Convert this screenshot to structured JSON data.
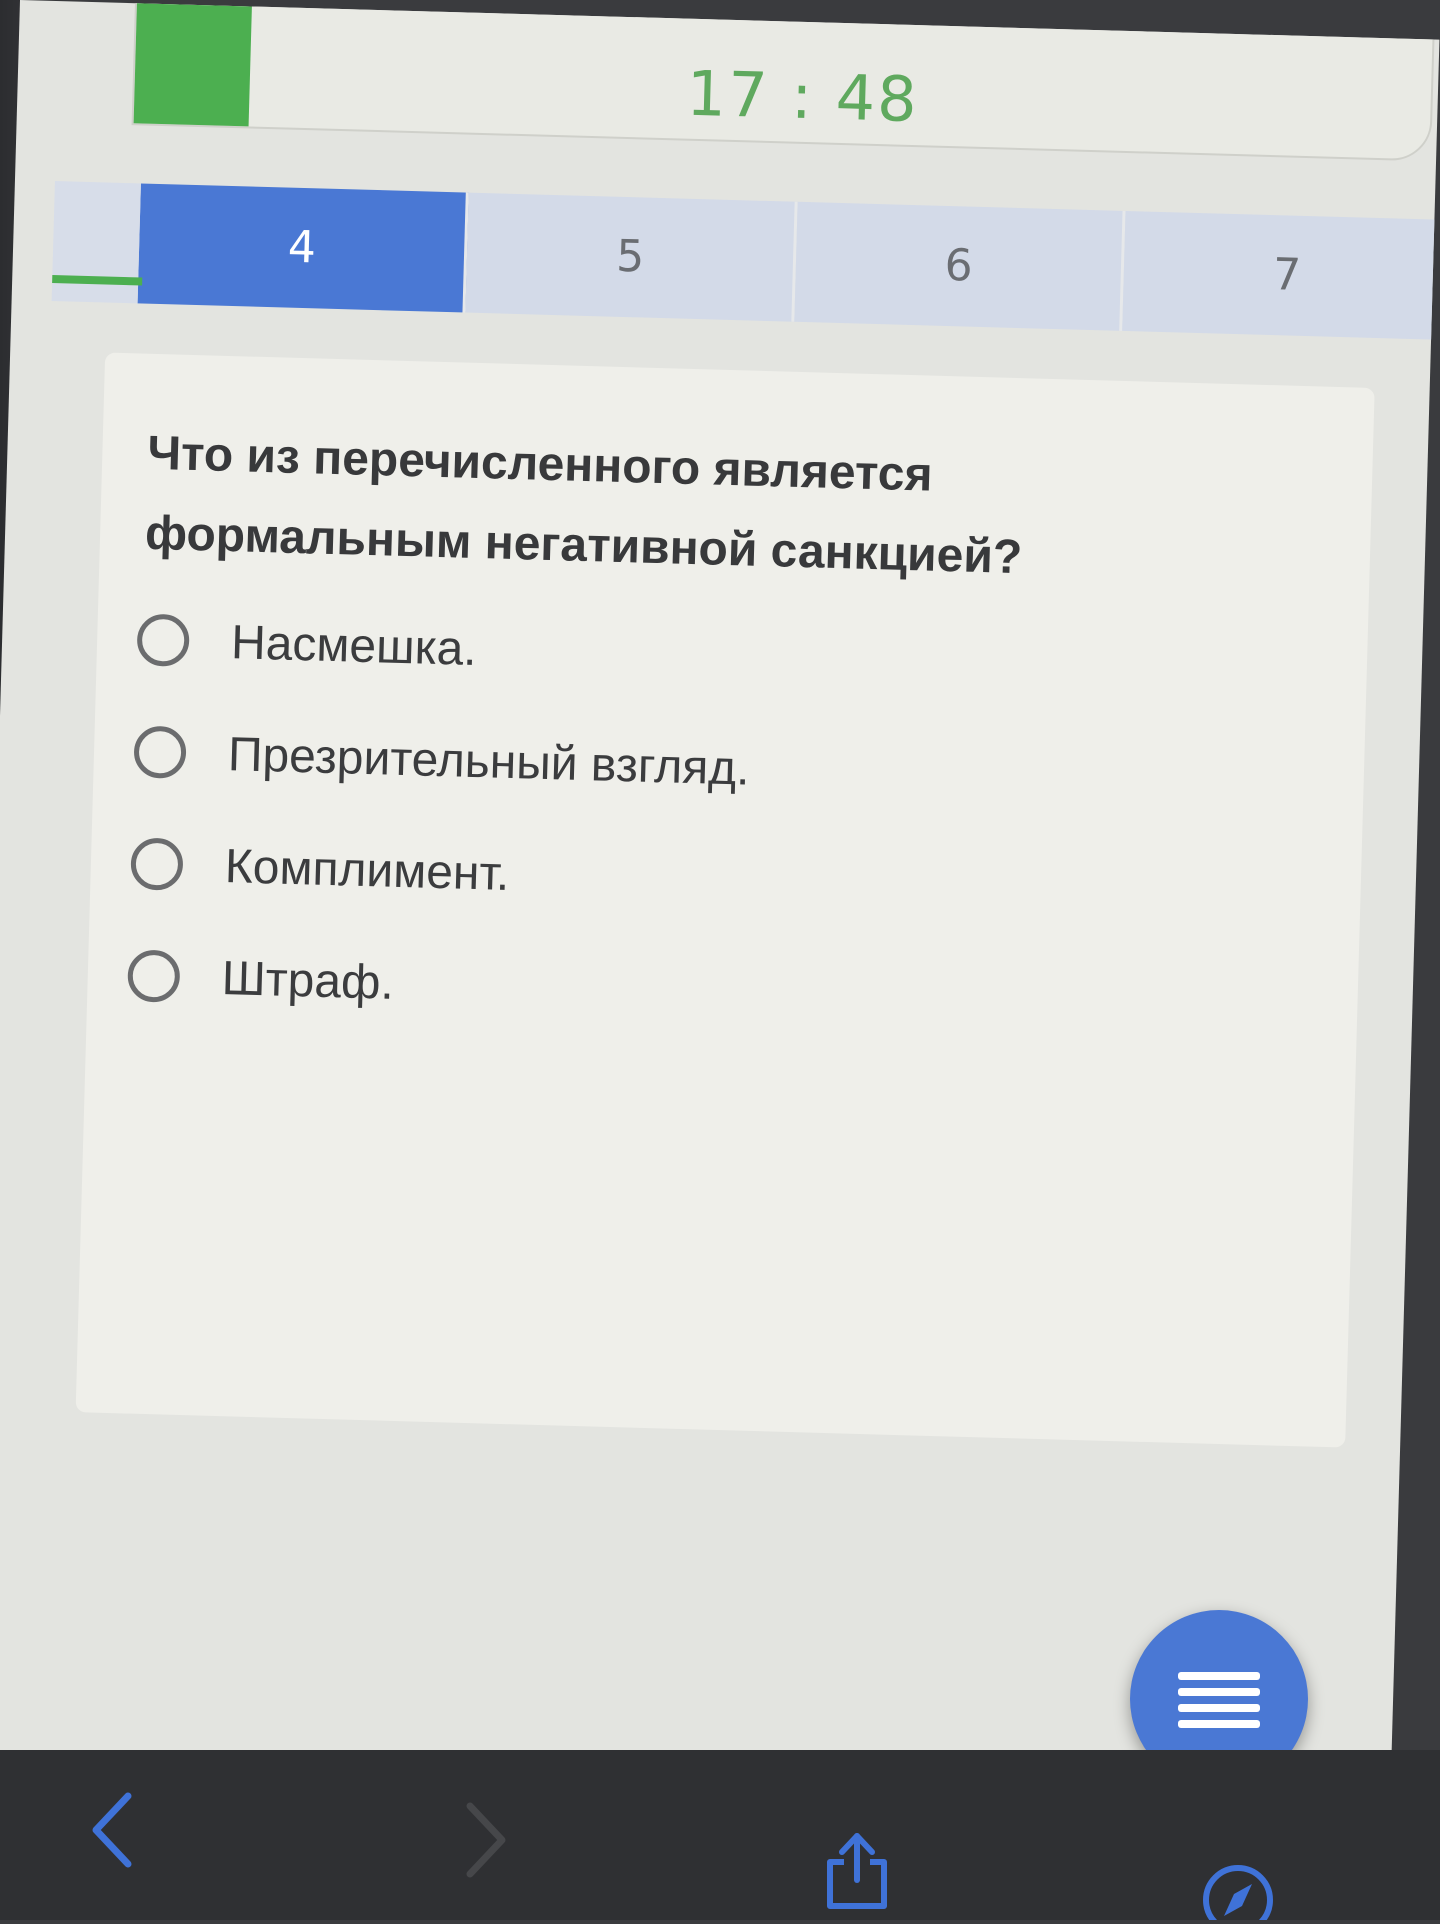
{
  "timer": {
    "time": "17 : 48",
    "color": "#5fa95e",
    "progress_fill_color": "#4caf50"
  },
  "tabs": [
    {
      "label": "4",
      "active": true
    },
    {
      "label": "5",
      "active": false
    },
    {
      "label": "6",
      "active": false
    },
    {
      "label": "7",
      "active": false
    }
  ],
  "question": {
    "text": "Что из перечисленного является формальным негативной санкцией?"
  },
  "options": [
    {
      "label": "Насмешка."
    },
    {
      "label": "Презрительный взгляд."
    },
    {
      "label": "Комплимент."
    },
    {
      "label": "Штраф."
    }
  ],
  "fab": {
    "icon": "menu-icon",
    "color": "#4a78d4"
  },
  "browser_toolbar": {
    "icons": [
      "back-arrow-icon",
      "forward-arrow-icon",
      "share-icon",
      "compass-icon"
    ],
    "accent_color": "#3f72d8"
  }
}
